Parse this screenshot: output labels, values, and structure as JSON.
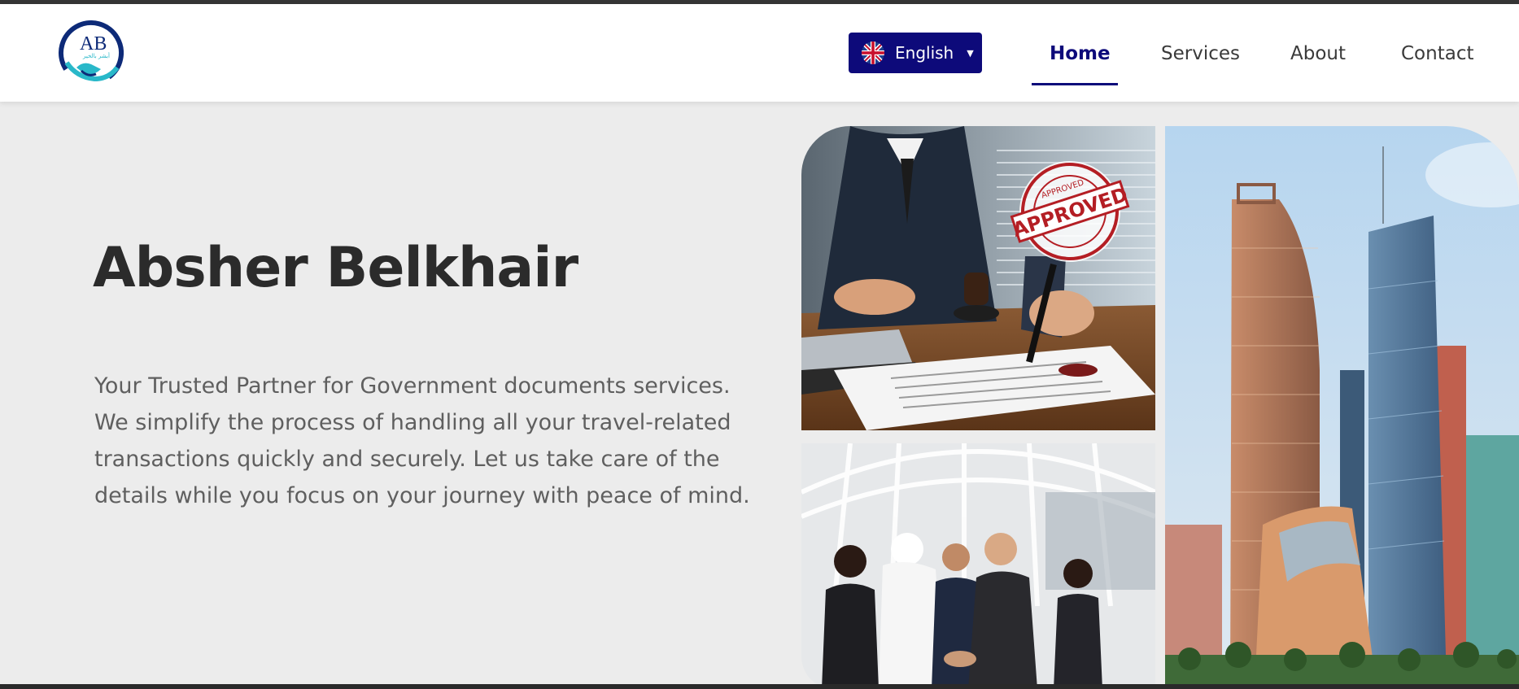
{
  "brand": {
    "logo_text": "AB",
    "logo_arabic": "أبشر بالخير"
  },
  "language": {
    "label": "English",
    "flag": "uk-flag-icon"
  },
  "nav": {
    "items": [
      {
        "label": "Home",
        "active": true
      },
      {
        "label": "Services",
        "active": false
      },
      {
        "label": "About",
        "active": false
      },
      {
        "label": "Contact",
        "active": false
      }
    ]
  },
  "hero": {
    "title": "Absher Belkhair",
    "description": "Your Trusted Partner for Government documents services. We simplify the process of handling all your travel-related transactions quickly and securely. Let us take care of the details while you focus on your journey with peace of mind."
  },
  "images": {
    "stamp_text": "APPROVED",
    "stamp_ring_text": "APPROVED",
    "photo1": "document-approval-photo",
    "photo2": "business-handshake-photo",
    "photo3": "city-skyscrapers-photo"
  },
  "colors": {
    "accent": "#0d0a7a",
    "background": "#ececec",
    "title": "#2b2b2b",
    "text": "#5f5f5f"
  }
}
